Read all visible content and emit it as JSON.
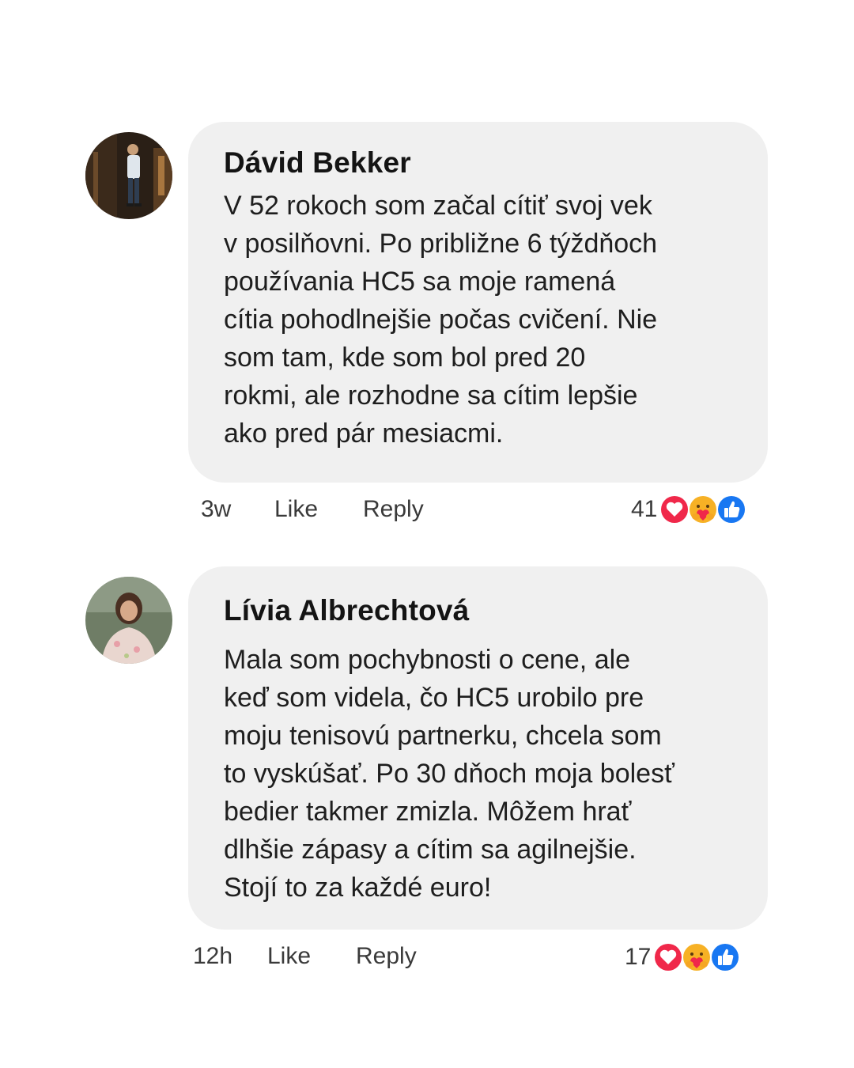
{
  "comments": [
    {
      "author": "Dávid Bekker",
      "text": "V 52 rokoch som začal cítiť svoj vek\nv posilňovni. Po približne 6 týždňoch\npoužívania HC5 sa moje ramená\ncítia pohodlnejšie počas cvičení. Nie\nsom tam, kde som bol pred 20\nrokmi, ale rozhodne sa cítim lepšie\nako pred pár mesiacmi.",
      "time": "3w",
      "like_label": "Like",
      "reply_label": "Reply",
      "reaction_count": "41",
      "reactions": [
        "heart-icon",
        "care-icon",
        "thumbs-up-icon"
      ]
    },
    {
      "author": "Lívia Albrechtová",
      "text": "Mala som pochybnosti o cene, ale\nkeď som videla, čo HC5 urobilo pre\nmoju tenisovú partnerku, chcela som\nto vyskúšať. Po 30 dňoch moja bolesť\nbedier takmer zmizla. Môžem hrať\ndlhšie zápasy a cítim sa agilnejšie.\nStojí to za každé euro!",
      "time": "12h",
      "like_label": "Like",
      "reply_label": "Reply",
      "reaction_count": "17",
      "reactions": [
        "heart-icon",
        "care-icon",
        "thumbs-up-icon"
      ]
    }
  ],
  "colors": {
    "bubble": "#f0f0f0",
    "heart": "#f0284a",
    "like": "#1877f2",
    "care": "#f7b125"
  }
}
